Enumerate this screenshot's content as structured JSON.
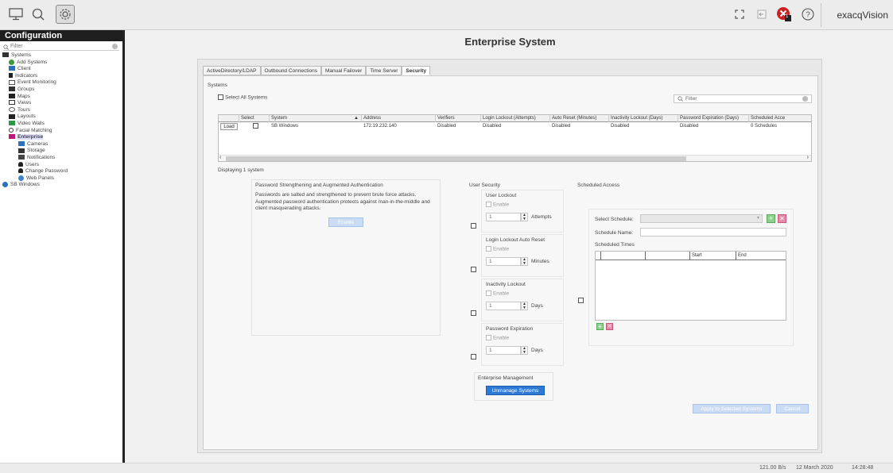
{
  "app": {
    "brand": "exacqVision",
    "colors": {
      "accent": "#2d7ad6",
      "error": "#cc2222"
    }
  },
  "toolbar": {
    "icons": [
      "monitor-icon",
      "search-icon",
      "gear-icon",
      "expand-icon",
      "exit-icon",
      "error-badge-icon",
      "help-icon"
    ],
    "badge_count": "1"
  },
  "sidebar": {
    "title": "Configuration",
    "filter_placeholder": "Filter",
    "items": [
      {
        "label": "Systems",
        "level": 0
      },
      {
        "label": "Add Systems",
        "level": 1
      },
      {
        "label": "Client",
        "level": 1
      },
      {
        "label": "Indicators",
        "level": 1
      },
      {
        "label": "Event Monitoring",
        "level": 1
      },
      {
        "label": "Groups",
        "level": 1
      },
      {
        "label": "Maps",
        "level": 1
      },
      {
        "label": "Views",
        "level": 1
      },
      {
        "label": "Tours",
        "level": 1
      },
      {
        "label": "Layouts",
        "level": 1
      },
      {
        "label": "Video Walls",
        "level": 1
      },
      {
        "label": "Facial Matching",
        "level": 1
      },
      {
        "label": "Enterprise",
        "level": 1
      },
      {
        "label": "Cameras",
        "level": 2
      },
      {
        "label": "Storage",
        "level": 2
      },
      {
        "label": "Notifications",
        "level": 2
      },
      {
        "label": "Users",
        "level": 2
      },
      {
        "label": "Change Password",
        "level": 2
      },
      {
        "label": "Web Panels",
        "level": 2
      },
      {
        "label": "SB Windows",
        "level": 0
      }
    ]
  },
  "main": {
    "title": "Enterprise System",
    "tabs": [
      "ActiveDirectory/LDAP",
      "Outbound Connections",
      "Manual Failover",
      "Time Server",
      "Security"
    ],
    "active_tab": "Security",
    "systems": {
      "section_label": "Systems",
      "select_all_label": "Select All Systems",
      "filter_placeholder": "Filter",
      "columns": [
        "",
        "Select",
        "System",
        "Address",
        "Verifiers",
        "Login Lockout (Attempts)",
        "Auto Reset (Minutes)",
        "Inactivity Lockout (Days)",
        "Password Expiration (Days)",
        "Scheduled Acce"
      ],
      "rows": [
        [
          "Load",
          "",
          "SB Windows",
          "172.19.232.140",
          "Disabled",
          "Disabled",
          "Disabled",
          "Disabled",
          "Disabled",
          "0 Schedules"
        ]
      ],
      "displaying": "Displaying 1 system"
    },
    "password": {
      "title": "Password Strengthening and Augmented Authentication",
      "text": "Passwords are salted and strengthened to prevent brute force attacks. Augmented password authentication protects against man-in-the-middle and client masquerading attacks.",
      "enable_label": "Enable"
    },
    "user_security": {
      "title": "User Security",
      "groups": [
        {
          "title": "User Lockout",
          "enable": "Enable",
          "value": "1",
          "unit": "Attempts"
        },
        {
          "title": "Login Lockout Auto Reset",
          "enable": "Enable",
          "value": "1",
          "unit": "Minutes"
        },
        {
          "title": "Inactivity Lockout",
          "enable": "Enable",
          "value": "1",
          "unit": "Days"
        },
        {
          "title": "Password Expiration",
          "enable": "Enable",
          "value": "1",
          "unit": "Days"
        }
      ]
    },
    "enterprise_mgmt": {
      "title": "Enterprise Management",
      "button": "Unmanage Systems"
    },
    "scheduled_access": {
      "title": "Scheduled Access",
      "select_schedule_label": "Select Schedule:",
      "schedule_name_label": "Schedule Name:",
      "scheduled_times_label": "Scheduled Times",
      "columns": [
        "",
        "",
        "",
        "Start",
        "End"
      ]
    },
    "actions": {
      "apply": "Apply to Selected Systems",
      "cancel": "Cancel"
    }
  },
  "status": {
    "bandwidth": "121.00 B/s",
    "date": "12 March 2020",
    "time": "14:28:48"
  }
}
